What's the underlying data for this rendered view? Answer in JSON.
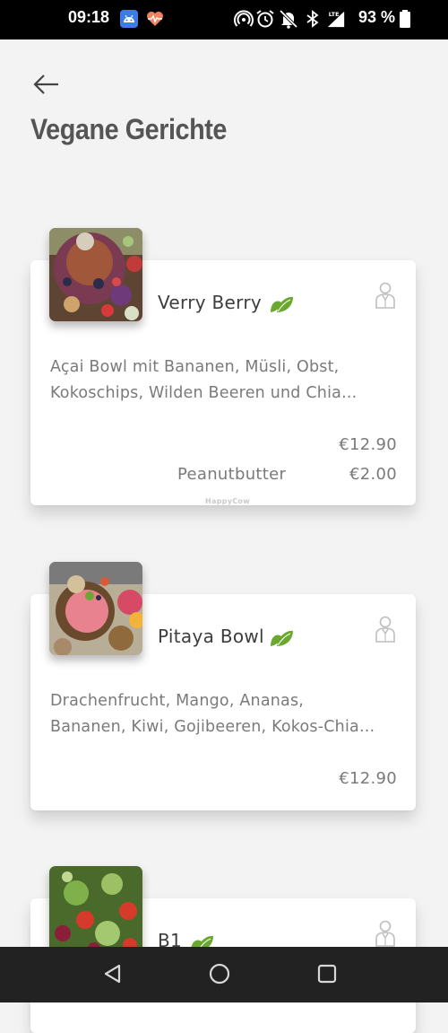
{
  "status_bar": {
    "time": "09:18",
    "battery_percent": "93 %",
    "icons": [
      "android-app-icon",
      "heart-pulse-icon",
      "hotspot-icon",
      "alarm-icon",
      "bell-off-icon",
      "bluetooth-icon",
      "lte-signal-icon",
      "battery-icon"
    ]
  },
  "header": {
    "back_icon": "back-arrow-icon",
    "title": "Vegane Gerichte"
  },
  "dishes": [
    {
      "name": "Verry Berry",
      "description_line1": "Açai Bowl mit Bananen, Müsli, Obst,",
      "description_line2": "Kokoschips, Wilden Beeren und Chia...",
      "price": "€12.90",
      "extra_name": "Peanutbutter",
      "extra_price": "€2.00",
      "watermark": "HappyCow",
      "icons": [
        "vegan-leaf-icon",
        "waiter-icon"
      ]
    },
    {
      "name": "Pitaya Bowl",
      "description_line1": "Drachenfrucht, Mango, Ananas,",
      "description_line2": "Bananen, Kiwi, Gojibeeren, Kokos-Chia...",
      "price": "€12.90",
      "icons": [
        "vegan-leaf-icon",
        "waiter-icon"
      ]
    },
    {
      "name": "B1",
      "icons": [
        "vegan-leaf-icon",
        "waiter-icon"
      ]
    }
  ],
  "colors": {
    "background": "#f3f3f3",
    "card": "#ffffff",
    "leaf_green": "#6aa832",
    "text_dark": "#3d3d3d",
    "text_muted": "#7a7a7a"
  },
  "nav_bar": {
    "icons": [
      "nav-back-icon",
      "nav-home-icon",
      "nav-recents-icon"
    ]
  }
}
